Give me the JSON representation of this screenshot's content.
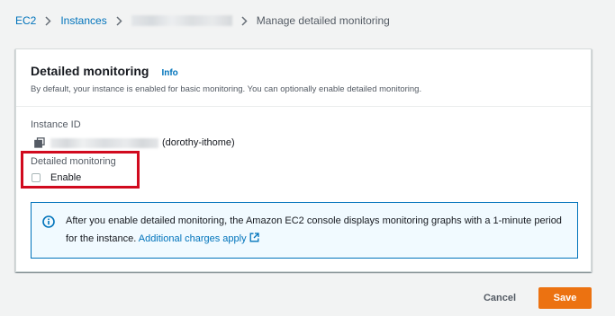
{
  "breadcrumb": {
    "items": [
      "EC2",
      "Instances"
    ],
    "current": "Manage detailed monitoring"
  },
  "card": {
    "title": "Detailed monitoring",
    "info_label": "Info",
    "description": "By default, your instance is enabled for basic monitoring. You can optionally enable detailed monitoring."
  },
  "instance": {
    "label": "Instance ID",
    "name": "(dorothy-ithome)"
  },
  "monitoring": {
    "label": "Detailed monitoring",
    "checkbox_label": "Enable",
    "checked": false
  },
  "alert": {
    "text": "After you enable detailed monitoring, the Amazon EC2 console displays monitoring graphs with a 1-minute period for the instance.",
    "link": "Additional charges apply"
  },
  "actions": {
    "cancel": "Cancel",
    "save": "Save"
  },
  "colors": {
    "accent": "#0073bb",
    "primary_button": "#ec7211",
    "highlight": "#d10a1e"
  }
}
